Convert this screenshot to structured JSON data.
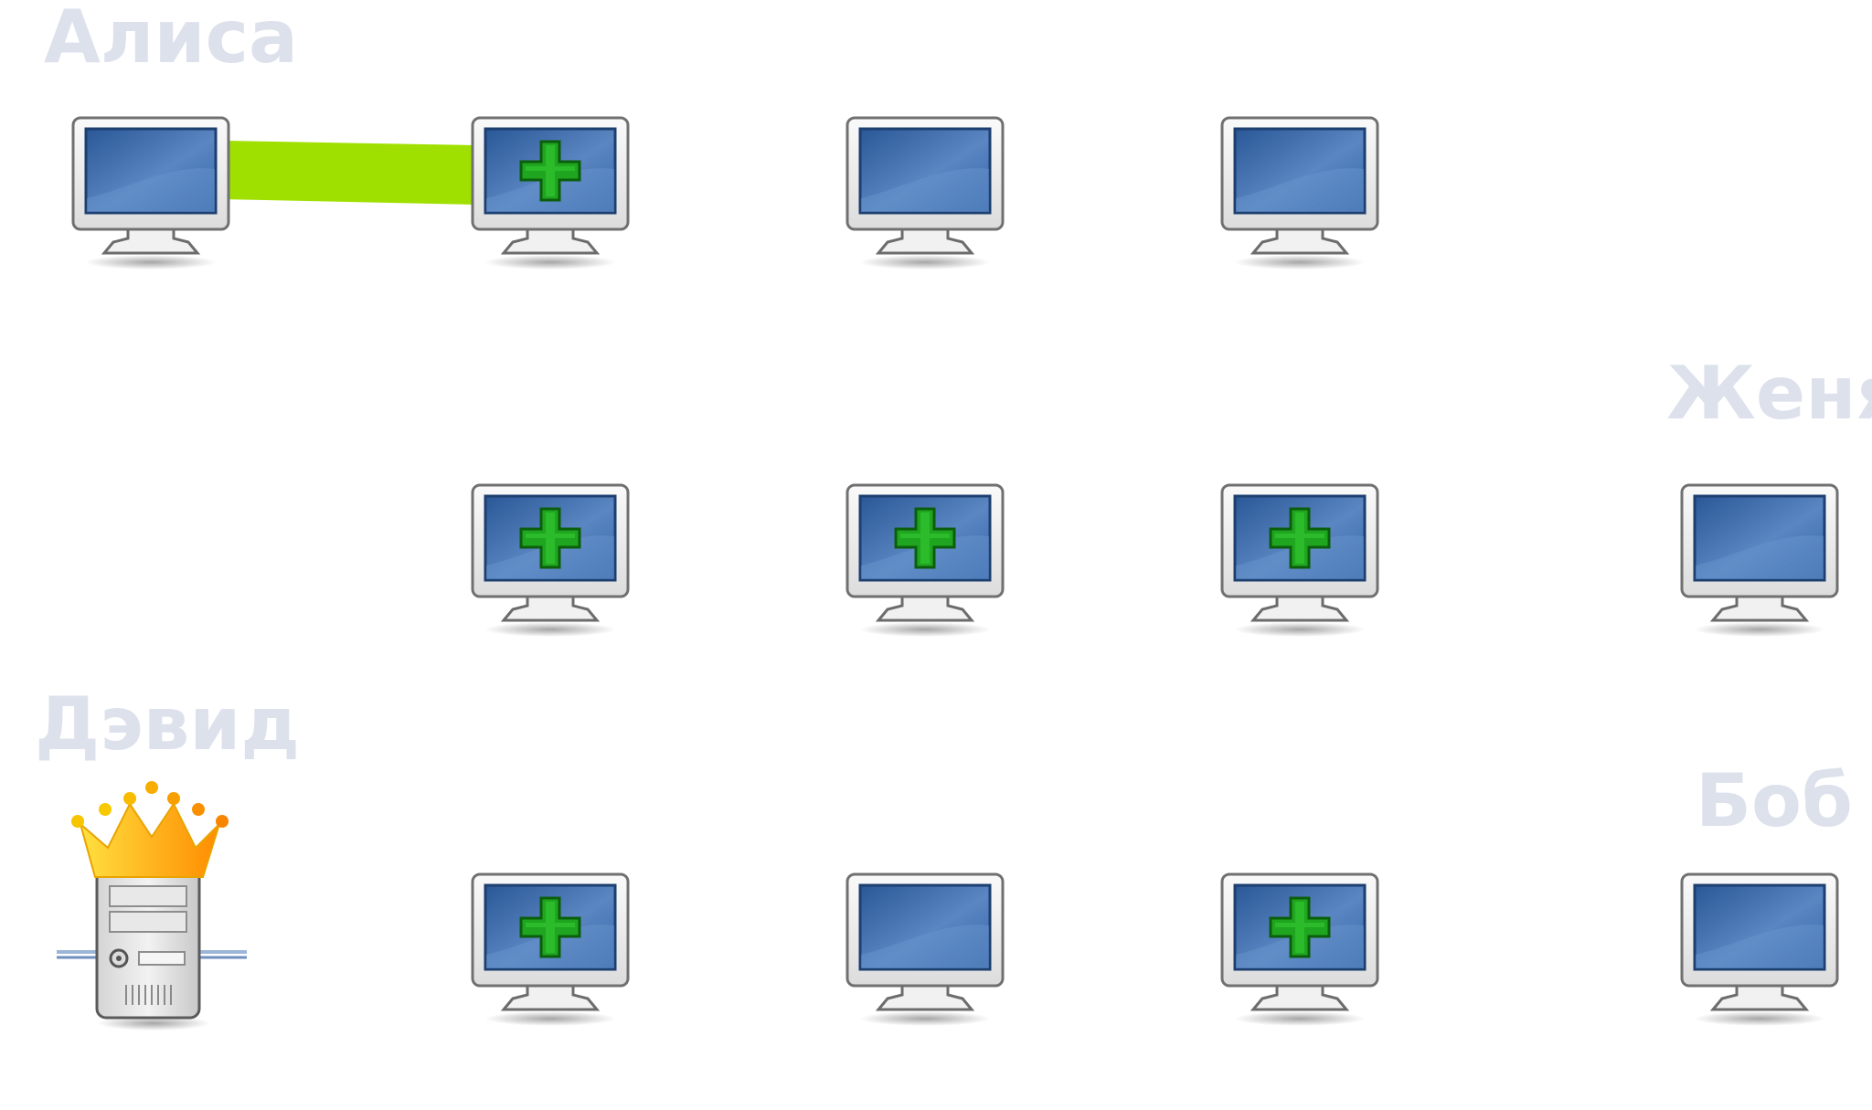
{
  "labels": {
    "alice": "Алиса",
    "zhenya": "Женя",
    "david": "Дэвид",
    "bob": "Боб"
  },
  "colors": {
    "label": "#dde1ec",
    "link": "#9fe000",
    "screen": "#3d6aa8",
    "plus": "#1aa11a",
    "crown": "#f3b100"
  },
  "nodes": [
    {
      "row": 1,
      "col": 1,
      "icon": "monitor-icon",
      "plus": false,
      "owner": "Алиса"
    },
    {
      "row": 1,
      "col": 2,
      "icon": "monitor-icon",
      "plus": true
    },
    {
      "row": 1,
      "col": 3,
      "icon": "monitor-icon",
      "plus": false
    },
    {
      "row": 1,
      "col": 4,
      "icon": "monitor-icon",
      "plus": false
    },
    {
      "row": 2,
      "col": 2,
      "icon": "monitor-icon",
      "plus": true
    },
    {
      "row": 2,
      "col": 3,
      "icon": "monitor-icon",
      "plus": true
    },
    {
      "row": 2,
      "col": 4,
      "icon": "monitor-icon",
      "plus": true
    },
    {
      "row": 2,
      "col": 5,
      "icon": "monitor-icon",
      "plus": false,
      "owner": "Женя"
    },
    {
      "row": 3,
      "col": 1,
      "icon": "crowned-server-icon",
      "plus": false,
      "owner": "Дэвид"
    },
    {
      "row": 3,
      "col": 2,
      "icon": "monitor-icon",
      "plus": true
    },
    {
      "row": 3,
      "col": 3,
      "icon": "monitor-icon",
      "plus": false
    },
    {
      "row": 3,
      "col": 4,
      "icon": "monitor-icon",
      "plus": true
    },
    {
      "row": 3,
      "col": 5,
      "icon": "monitor-icon",
      "plus": false,
      "owner": "Боб"
    }
  ],
  "links": [
    {
      "from": "row1-col1",
      "to": "row1-col2"
    }
  ]
}
